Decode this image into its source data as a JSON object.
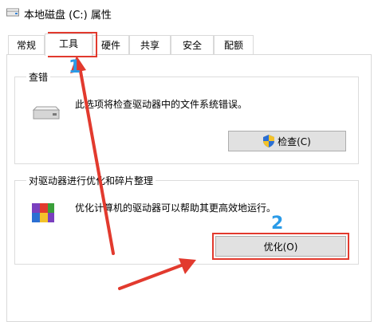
{
  "window": {
    "title": "本地磁盘 (C:) 属性",
    "icon": "drive-icon"
  },
  "tabs": [
    {
      "label": "常规"
    },
    {
      "label": "工具",
      "active": true
    },
    {
      "label": "硬件"
    },
    {
      "label": "共享"
    },
    {
      "label": "安全"
    },
    {
      "label": "配额"
    }
  ],
  "check_section": {
    "title": "查错",
    "icon": "hard-drive-icon",
    "description": "此选项将检查驱动器中的文件系统错误。",
    "button_label": "检查(C)",
    "button_icon": "uac-shield-icon"
  },
  "optimize_section": {
    "title": "对驱动器进行优化和碎片整理",
    "icon": "defrag-icon",
    "description": "优化计算机的驱动器可以帮助其更高效地运行。",
    "button_label": "优化(O)"
  },
  "annotations": {
    "step1": "1",
    "step2": "2",
    "color": "#e23a2e",
    "number_color": "#2a9be8"
  }
}
